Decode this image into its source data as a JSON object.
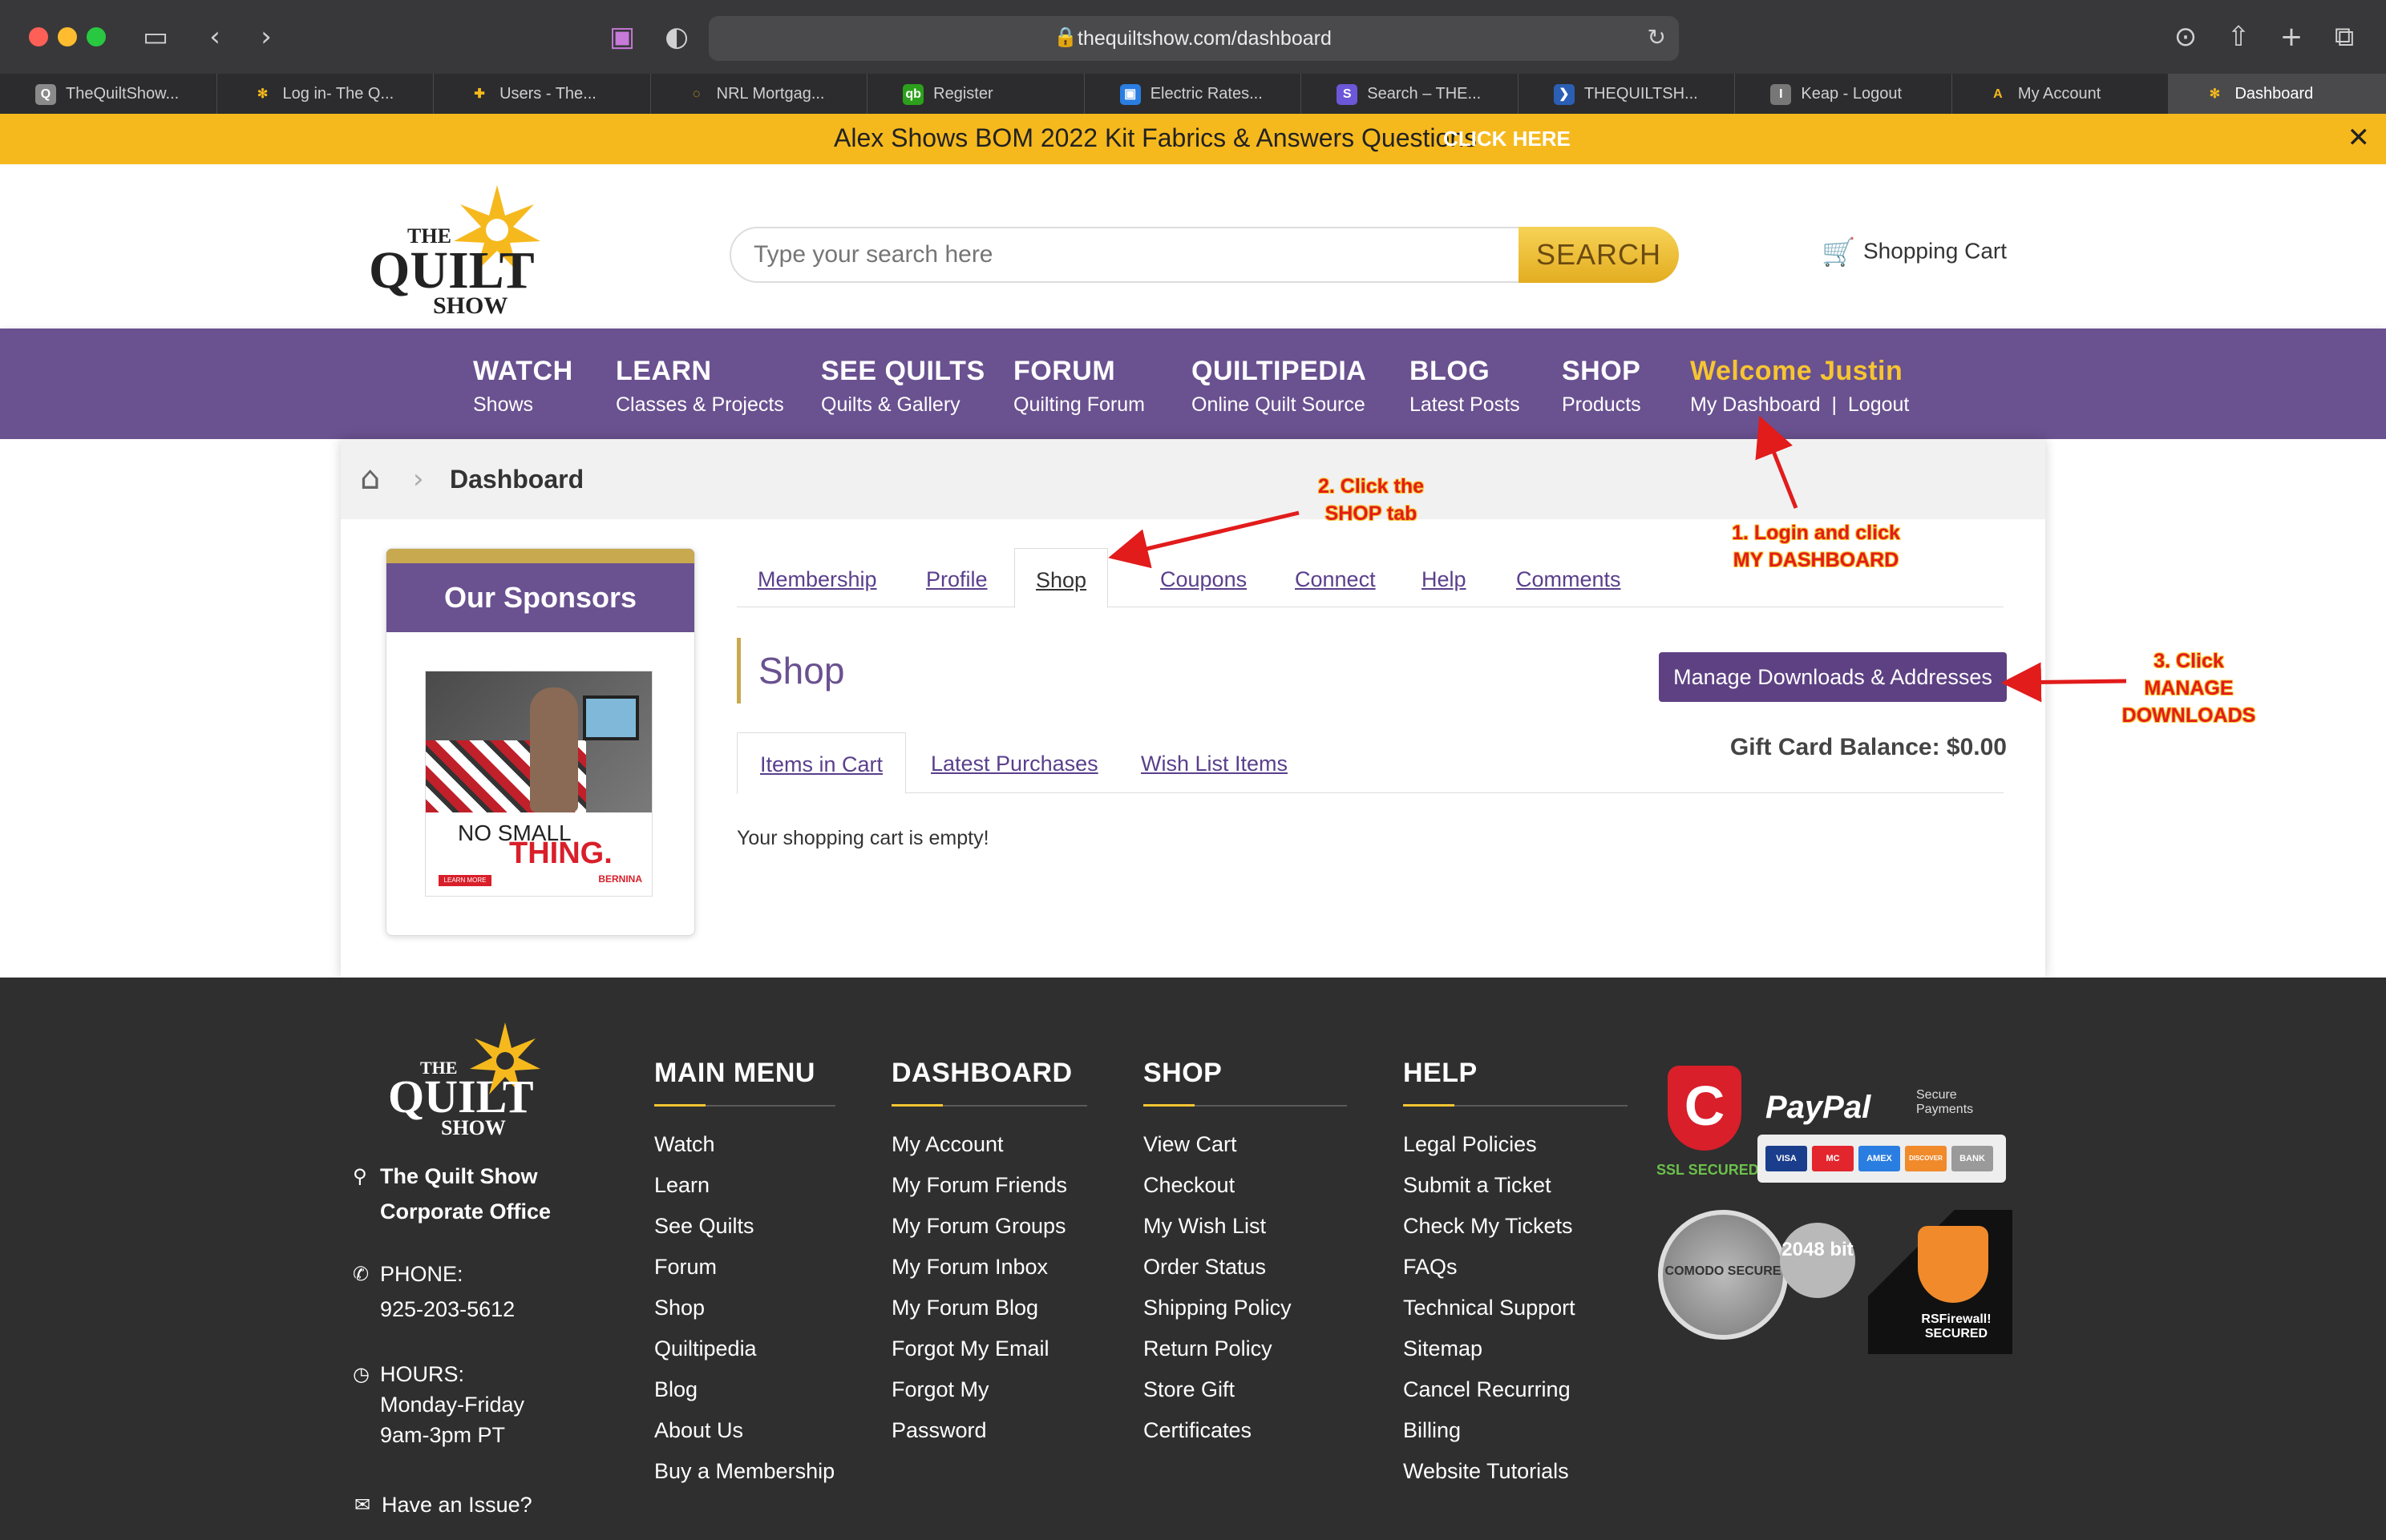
{
  "browser": {
    "url": "thequiltshow.com/dashboard",
    "tabs": [
      {
        "label": "TheQuiltShow...",
        "icon": "Q",
        "color": "#8a8a8a"
      },
      {
        "label": "Log in- The Q...",
        "icon": "✻",
        "color": "transparent"
      },
      {
        "label": "Users - The...",
        "icon": "✚",
        "color": "transparent"
      },
      {
        "label": "NRL Mortgag...",
        "icon": "◌",
        "color": "transparent"
      },
      {
        "label": "Register",
        "icon": "qb",
        "color": "#2ca01c"
      },
      {
        "label": "Electric Rates...",
        "icon": "▣",
        "color": "#2a7de1"
      },
      {
        "label": "Search – THE...",
        "icon": "S",
        "color": "#6b57d8"
      },
      {
        "label": "THEQUILTSH...",
        "icon": "❯",
        "color": "#2b5fb5"
      },
      {
        "label": "Keap - Logout",
        "icon": "I",
        "color": "#777"
      },
      {
        "label": "My Account",
        "icon": "A",
        "color": "transparent"
      },
      {
        "label": "Dashboard",
        "icon": "✻",
        "color": "transparent"
      }
    ]
  },
  "promo": {
    "text": "Alex Shows BOM 2022 Kit Fabrics & Answers Questions",
    "cta": "CLICK HERE"
  },
  "header": {
    "logo": {
      "the": "THE",
      "quilt": "QUILT",
      "show": "SHOW"
    },
    "search_placeholder": "Type your search here",
    "search_button": "SEARCH",
    "cart_label": "Shopping Cart"
  },
  "nav": {
    "items": [
      {
        "title": "WATCH",
        "sub": "Shows"
      },
      {
        "title": "LEARN",
        "sub": "Classes & Projects"
      },
      {
        "title": "SEE QUILTS",
        "sub": "Quilts & Gallery"
      },
      {
        "title": "FORUM",
        "sub": "Quilting Forum"
      },
      {
        "title": "QUILTIPEDIA",
        "sub": "Online Quilt Source"
      },
      {
        "title": "BLOG",
        "sub": "Latest Posts"
      },
      {
        "title": "SHOP",
        "sub": "Products"
      }
    ],
    "welcome": "Welcome Justin",
    "my_dashboard": "My Dashboard",
    "divider": "|",
    "logout": "Logout"
  },
  "breadcrumb": {
    "title": "Dashboard"
  },
  "sponsor": {
    "heading": "Our Sponsors",
    "ad_line1": "NO SMALL",
    "ad_line2": "THING.",
    "ad_learn_more": "LEARN MORE",
    "ad_brand": "BERNINA"
  },
  "dashboard_tabs": [
    "Membership",
    "Profile",
    "Shop",
    "Coupons",
    "Connect",
    "Help",
    "Comments"
  ],
  "shop": {
    "title": "Shop",
    "manage_button": "Manage Downloads & Addresses",
    "gift_card": "Gift Card Balance: $0.00",
    "subtabs": [
      "Items in Cart",
      "Latest Purchases",
      "Wish List Items"
    ],
    "empty_message": "Your shopping cart is empty!"
  },
  "annotations": {
    "step1_line1": "1. Login and click",
    "step1_line2": "MY DASHBOARD",
    "step2_line1": "2. Click the",
    "step2_line2": "SHOP tab",
    "step3_line1": "3. Click",
    "step3_line2": "MANAGE",
    "step3_line3": "DOWNLOADS"
  },
  "footer": {
    "office_line1": "The Quilt Show",
    "office_line2": "Corporate Office",
    "phone_label": "PHONE:",
    "phone": "925-203-5612",
    "hours_label": "HOURS:",
    "hours_days": "Monday-Friday",
    "hours_time": "9am-3pm PT",
    "issue": "Have an Issue?",
    "columns": [
      {
        "heading": "MAIN MENU",
        "links": [
          "Watch",
          "Learn",
          "See Quilts",
          "Forum",
          "Shop",
          "Quiltipedia",
          "Blog",
          "About Us",
          "Buy a Membership"
        ]
      },
      {
        "heading": "DASHBOARD",
        "links": [
          "My Account",
          "My Forum Friends",
          "My Forum Groups",
          "My Forum Inbox",
          "My Forum Blog",
          "Forgot My Email",
          "Forgot My Password"
        ]
      },
      {
        "heading": "SHOP",
        "links": [
          "View Cart",
          "Checkout",
          "My Wish List",
          "Order Status",
          "Shipping Policy",
          "Return Policy",
          "Store Gift Certificates"
        ]
      },
      {
        "heading": "HELP",
        "links": [
          "Legal Policies",
          "Submit a Ticket",
          "Check My Tickets",
          "FAQs",
          "Technical Support",
          "Sitemap",
          "Cancel Recurring Billing",
          "Website Tutorials"
        ]
      }
    ],
    "badges": {
      "ssl": "SSL SECURED",
      "paypal": "PayPal",
      "secure_payments": "Secure Payments",
      "cards": [
        "VISA",
        "MC",
        "AMEX",
        "DISCOVER",
        "BANK"
      ],
      "comodo": "COMODO SECURE",
      "bits": "2048 bit",
      "rsfirewall": "RSFirewall! SECURED"
    }
  }
}
